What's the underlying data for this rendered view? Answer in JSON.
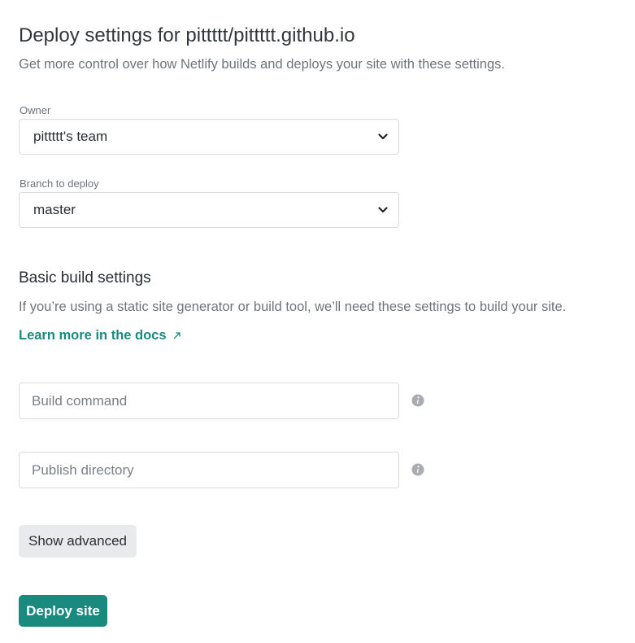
{
  "header": {
    "title": "Deploy settings for pittttt/pittttt.github.io",
    "subtitle": "Get more control over how Netlify builds and deploys your site with these settings."
  },
  "owner": {
    "label": "Owner",
    "value": "pittttt's team"
  },
  "branch": {
    "label": "Branch to deploy",
    "value": "master"
  },
  "build_settings": {
    "title": "Basic build settings",
    "description": "If you’re using a static site generator or build tool, we’ll need these settings to build your site.",
    "docs_link": "Learn more in the docs"
  },
  "build_command": {
    "placeholder": "Build command",
    "value": ""
  },
  "publish_directory": {
    "placeholder": "Publish directory",
    "value": ""
  },
  "actions": {
    "show_advanced": "Show advanced",
    "deploy": "Deploy site"
  },
  "colors": {
    "accent": "#1b8a7e",
    "info_icon": "#a9adb2"
  },
  "icons": {
    "select_chevron": "chevron-down-icon",
    "external_link": "external-link-arrow-icon",
    "info": "info-icon"
  }
}
